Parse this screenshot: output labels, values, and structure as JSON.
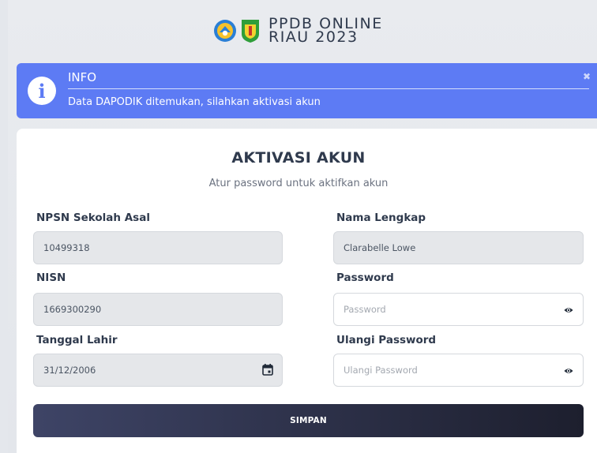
{
  "header": {
    "brand_line1": "PPDB ONLINE",
    "brand_line2": "RIAU 2023"
  },
  "alert": {
    "title": "INFO",
    "message": "Data DAPODIK ditemukan, silahkan aktivasi akun",
    "close_glyph": "✖",
    "icon_glyph": "i",
    "color": "#5d7bf4"
  },
  "card": {
    "title": "AKTIVASI AKUN",
    "subtitle": "Atur password untuk aktifkan akun"
  },
  "form": {
    "npsn_label": "NPSN Sekolah Asal",
    "npsn_value": "10499318",
    "nisn_label": "NISN",
    "nisn_value": "1669300290",
    "tgl_label": "Tanggal Lahir",
    "tgl_value": "31/12/2006",
    "nama_label": "Nama Lengkap",
    "nama_value": "Clarabelle Lowe",
    "password_label": "Password",
    "password_placeholder": "Password",
    "ulangi_label": "Ulangi Password",
    "ulangi_placeholder": "Ulangi Password"
  },
  "submit": {
    "label": "SIMPAN",
    "color": "#2b2f45"
  },
  "icons": {
    "info": "info-icon",
    "close": "close-icon",
    "calendar": "calendar-icon",
    "eye": "eye-icon"
  }
}
